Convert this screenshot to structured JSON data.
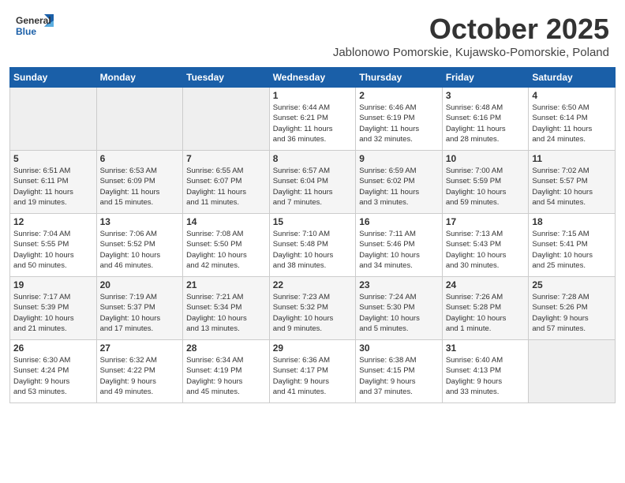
{
  "header": {
    "logo_general": "General",
    "logo_blue": "Blue",
    "month_title": "October 2025",
    "location": "Jablonowo Pomorskie, Kujawsko-Pomorskie, Poland"
  },
  "calendar": {
    "weekdays": [
      "Sunday",
      "Monday",
      "Tuesday",
      "Wednesday",
      "Thursday",
      "Friday",
      "Saturday"
    ],
    "weeks": [
      [
        {
          "day": "",
          "info": ""
        },
        {
          "day": "",
          "info": ""
        },
        {
          "day": "",
          "info": ""
        },
        {
          "day": "1",
          "info": "Sunrise: 6:44 AM\nSunset: 6:21 PM\nDaylight: 11 hours\nand 36 minutes."
        },
        {
          "day": "2",
          "info": "Sunrise: 6:46 AM\nSunset: 6:19 PM\nDaylight: 11 hours\nand 32 minutes."
        },
        {
          "day": "3",
          "info": "Sunrise: 6:48 AM\nSunset: 6:16 PM\nDaylight: 11 hours\nand 28 minutes."
        },
        {
          "day": "4",
          "info": "Sunrise: 6:50 AM\nSunset: 6:14 PM\nDaylight: 11 hours\nand 24 minutes."
        }
      ],
      [
        {
          "day": "5",
          "info": "Sunrise: 6:51 AM\nSunset: 6:11 PM\nDaylight: 11 hours\nand 19 minutes."
        },
        {
          "day": "6",
          "info": "Sunrise: 6:53 AM\nSunset: 6:09 PM\nDaylight: 11 hours\nand 15 minutes."
        },
        {
          "day": "7",
          "info": "Sunrise: 6:55 AM\nSunset: 6:07 PM\nDaylight: 11 hours\nand 11 minutes."
        },
        {
          "day": "8",
          "info": "Sunrise: 6:57 AM\nSunset: 6:04 PM\nDaylight: 11 hours\nand 7 minutes."
        },
        {
          "day": "9",
          "info": "Sunrise: 6:59 AM\nSunset: 6:02 PM\nDaylight: 11 hours\nand 3 minutes."
        },
        {
          "day": "10",
          "info": "Sunrise: 7:00 AM\nSunset: 5:59 PM\nDaylight: 10 hours\nand 59 minutes."
        },
        {
          "day": "11",
          "info": "Sunrise: 7:02 AM\nSunset: 5:57 PM\nDaylight: 10 hours\nand 54 minutes."
        }
      ],
      [
        {
          "day": "12",
          "info": "Sunrise: 7:04 AM\nSunset: 5:55 PM\nDaylight: 10 hours\nand 50 minutes."
        },
        {
          "day": "13",
          "info": "Sunrise: 7:06 AM\nSunset: 5:52 PM\nDaylight: 10 hours\nand 46 minutes."
        },
        {
          "day": "14",
          "info": "Sunrise: 7:08 AM\nSunset: 5:50 PM\nDaylight: 10 hours\nand 42 minutes."
        },
        {
          "day": "15",
          "info": "Sunrise: 7:10 AM\nSunset: 5:48 PM\nDaylight: 10 hours\nand 38 minutes."
        },
        {
          "day": "16",
          "info": "Sunrise: 7:11 AM\nSunset: 5:46 PM\nDaylight: 10 hours\nand 34 minutes."
        },
        {
          "day": "17",
          "info": "Sunrise: 7:13 AM\nSunset: 5:43 PM\nDaylight: 10 hours\nand 30 minutes."
        },
        {
          "day": "18",
          "info": "Sunrise: 7:15 AM\nSunset: 5:41 PM\nDaylight: 10 hours\nand 25 minutes."
        }
      ],
      [
        {
          "day": "19",
          "info": "Sunrise: 7:17 AM\nSunset: 5:39 PM\nDaylight: 10 hours\nand 21 minutes."
        },
        {
          "day": "20",
          "info": "Sunrise: 7:19 AM\nSunset: 5:37 PM\nDaylight: 10 hours\nand 17 minutes."
        },
        {
          "day": "21",
          "info": "Sunrise: 7:21 AM\nSunset: 5:34 PM\nDaylight: 10 hours\nand 13 minutes."
        },
        {
          "day": "22",
          "info": "Sunrise: 7:23 AM\nSunset: 5:32 PM\nDaylight: 10 hours\nand 9 minutes."
        },
        {
          "day": "23",
          "info": "Sunrise: 7:24 AM\nSunset: 5:30 PM\nDaylight: 10 hours\nand 5 minutes."
        },
        {
          "day": "24",
          "info": "Sunrise: 7:26 AM\nSunset: 5:28 PM\nDaylight: 10 hours\nand 1 minute."
        },
        {
          "day": "25",
          "info": "Sunrise: 7:28 AM\nSunset: 5:26 PM\nDaylight: 9 hours\nand 57 minutes."
        }
      ],
      [
        {
          "day": "26",
          "info": "Sunrise: 6:30 AM\nSunset: 4:24 PM\nDaylight: 9 hours\nand 53 minutes."
        },
        {
          "day": "27",
          "info": "Sunrise: 6:32 AM\nSunset: 4:22 PM\nDaylight: 9 hours\nand 49 minutes."
        },
        {
          "day": "28",
          "info": "Sunrise: 6:34 AM\nSunset: 4:19 PM\nDaylight: 9 hours\nand 45 minutes."
        },
        {
          "day": "29",
          "info": "Sunrise: 6:36 AM\nSunset: 4:17 PM\nDaylight: 9 hours\nand 41 minutes."
        },
        {
          "day": "30",
          "info": "Sunrise: 6:38 AM\nSunset: 4:15 PM\nDaylight: 9 hours\nand 37 minutes."
        },
        {
          "day": "31",
          "info": "Sunrise: 6:40 AM\nSunset: 4:13 PM\nDaylight: 9 hours\nand 33 minutes."
        },
        {
          "day": "",
          "info": ""
        }
      ]
    ]
  }
}
